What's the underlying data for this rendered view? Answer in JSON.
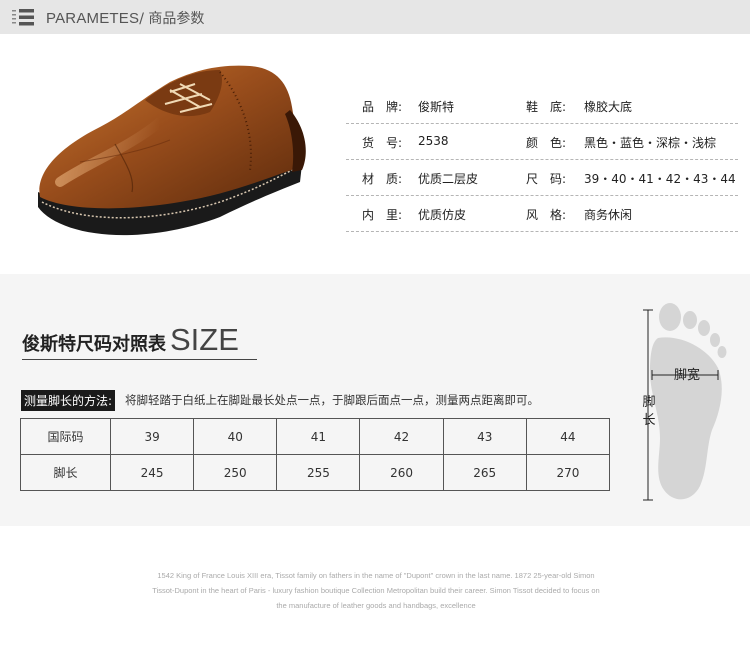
{
  "header": {
    "title_en": "PARAMETES",
    "separator": "/",
    "title_cn": "商品参数"
  },
  "params": [
    {
      "label1": "品　牌:",
      "value1": "俊斯特",
      "label2": "鞋　底:",
      "value2": "橡胶大底"
    },
    {
      "label1": "货　号:",
      "value1": "2538",
      "label2": "颜　色:",
      "value2": "黑色・蓝色・深棕・浅棕"
    },
    {
      "label1": "材　质:",
      "value1": "优质二层皮",
      "label2": "尺　码:",
      "value2": "39・40・41・42・43・44"
    },
    {
      "label1": "内　里:",
      "value1": "优质仿皮",
      "label2": "风　格:",
      "value2": "商务休闲"
    }
  ],
  "size_section": {
    "title_cn": "俊斯特尺码对照表",
    "title_en": "SIZE",
    "measure_label": "测量脚长的方法:",
    "measure_text": "将脚轻踏于白纸上在脚趾最长处点一点，于脚跟后面点一点，测量两点距离即可。"
  },
  "size_table": {
    "row1_label": "国际码",
    "row2_label": "脚长",
    "sizes": [
      "39",
      "40",
      "41",
      "42",
      "43",
      "44"
    ],
    "lengths": [
      "245",
      "250",
      "255",
      "260",
      "265",
      "270"
    ]
  },
  "foot_diagram": {
    "width_label": "脚宽",
    "length_label": "脚长"
  },
  "brand_story": {
    "line1": "1542 King of France Louis XIII era, Tissot family on fathers in the name of \"Dupont\" crown in the last name. 1872 25-year-old Simon",
    "line2": "Tissot-Dupont in the heart of Paris - luxury fashion boutique Collection Metropolitan build their career. Simon Tissot decided to focus on",
    "line3": "the manufacture of leather goods and handbags, excellence"
  },
  "colors": {
    "header_bg": "#e6e6e6",
    "shoe_leather": "#9a4e1c",
    "sole": "#1a1a1a"
  }
}
